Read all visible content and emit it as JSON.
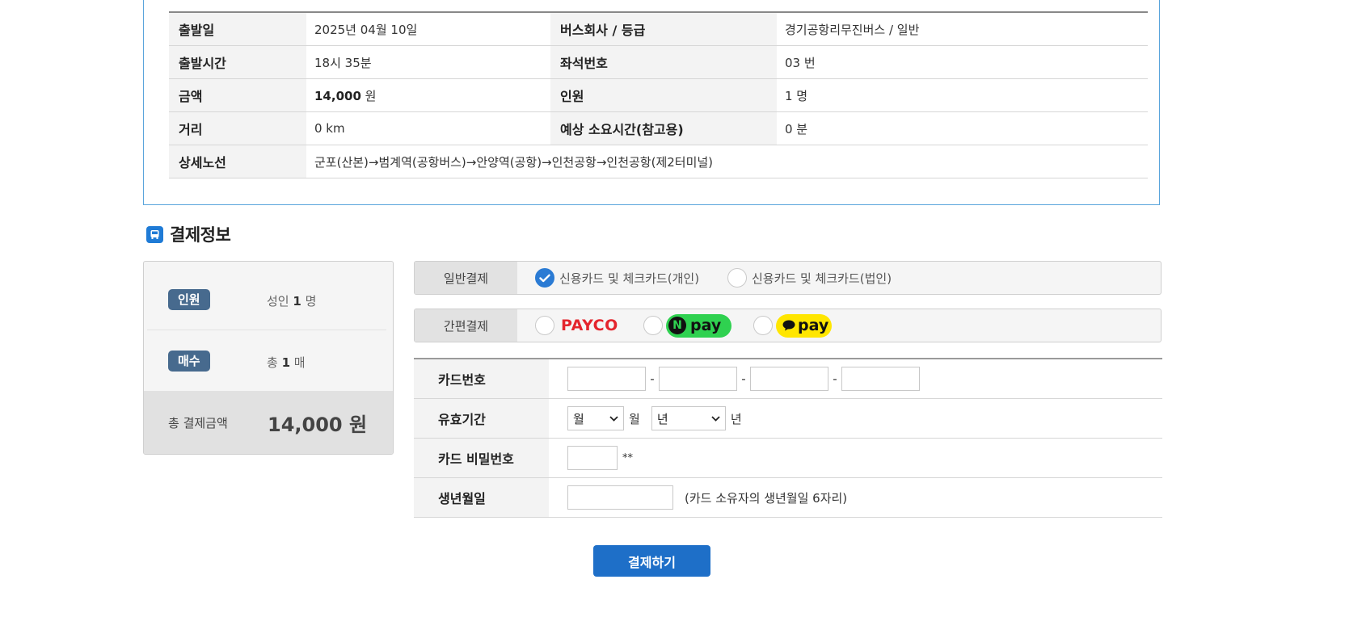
{
  "trip_info": {
    "rows": [
      {
        "label1": "출발일",
        "value1": "2025년 04월 10일",
        "label2": "버스회사 / 등급",
        "value2": "경기공항리무진버스 / 일반"
      },
      {
        "label1": "출발시간",
        "value1": "18시 35분",
        "label2": "좌석번호",
        "value2": "03 번"
      },
      {
        "label1": "금액",
        "value1_amount": "14,000",
        "value1_unit": " 원",
        "label2": "인원",
        "value2": "1 명"
      },
      {
        "label1": "거리",
        "value1": "0 km",
        "label2": "예상 소요시간(참고용)",
        "value2": "0 분"
      },
      {
        "label1": "상세노선",
        "value1": "군포(산본)→범계역(공항버스)→안양역(공항)→인천공항→인천공항(제2터미널)"
      }
    ]
  },
  "section_title": "결제정보",
  "summary": {
    "people_label": "인원",
    "people_prefix": "성인 ",
    "people_count": "1",
    "people_unit": " 명",
    "tickets_label": "매수",
    "tickets_prefix": "총 ",
    "tickets_count": "1",
    "tickets_unit": " 매",
    "total_label": "총 결제금액",
    "total_value": "14,000 원"
  },
  "payment": {
    "general_label": "일반결제",
    "general_options": [
      "신용카드 및 체크카드(개인)",
      "신용카드 및 체크카드(법인)"
    ],
    "easy_label": "간편결제",
    "payco": "PAYCO",
    "npay_n": "N",
    "npay": "pay",
    "kpay": "pay"
  },
  "card_form": {
    "card_number_label": "카드번호",
    "dash": "-",
    "expiry_label": "유효기간",
    "month_select": "월",
    "month_unit": "월",
    "year_select": "년",
    "year_unit": "년",
    "password_label": "카드 비밀번호",
    "password_suffix": "**",
    "birth_label": "생년월일",
    "birth_note": "(카드 소유자의 생년월일 6자리)"
  },
  "submit_label": "결제하기",
  "colors": {
    "accent": "#1e6fc8",
    "badge": "#476a8e",
    "box_border": "#5aa5dc",
    "payco_red": "#e4252d",
    "npay_green": "#2fd150",
    "kpay_yellow": "#ffe600"
  }
}
